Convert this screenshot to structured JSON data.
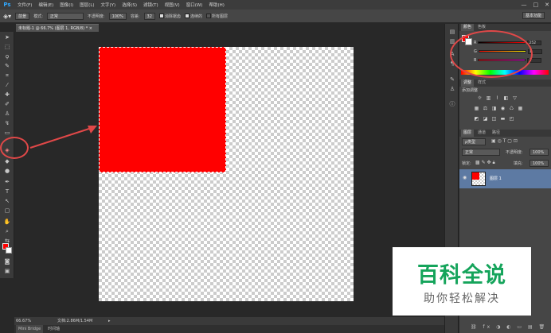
{
  "app": {
    "logo": "Ps",
    "menus": [
      "文件(F)",
      "编辑(E)",
      "图像(I)",
      "图层(L)",
      "文字(Y)",
      "选择(S)",
      "滤镜(T)",
      "视图(V)",
      "窗口(W)",
      "帮助(H)"
    ],
    "window_controls": [
      "—",
      "□",
      "✕"
    ]
  },
  "options": {
    "fill_source": "前景",
    "mode_label": "模式:",
    "mode_value": "正常",
    "opacity_label": "不透明度:",
    "opacity_value": "100%",
    "tolerance_label": "容差:",
    "tolerance_value": "32",
    "antialias_label": "消除锯齿",
    "contiguous_label": "连续的",
    "all_layers_label": "所有图层",
    "workspace": "基本功能"
  },
  "document": {
    "tab_label": "未标题-1 @ 66.7% (图层 1, RGB/8) *  ×",
    "zoom": "66.67%",
    "doc_info": "文档:2.86M/1.54M"
  },
  "bottom_tabs": [
    "Mini Bridge",
    "时间轴"
  ],
  "color_panel": {
    "tabs": [
      "颜色",
      "色板"
    ],
    "channels": [
      {
        "label": "R",
        "value": "252"
      },
      {
        "label": "G",
        "value": "1"
      },
      {
        "label": "B",
        "value": "1"
      }
    ],
    "foreground": "#ff0000"
  },
  "adjust_panel": {
    "tabs": [
      "调整",
      "样式"
    ],
    "title": "添加调整"
  },
  "layers_panel": {
    "tabs": [
      "图层",
      "通道",
      "路径"
    ],
    "filter_label": "ρ类型",
    "blend_mode": "正常",
    "opacity_label": "不透明度:",
    "opacity_value": "100%",
    "lock_label": "锁定:",
    "fill_label": "填充:",
    "fill_value": "100%",
    "layers": [
      {
        "name": "图层 1"
      }
    ]
  },
  "watermark": {
    "title": "百科全说",
    "subtitle": "助你轻松解决"
  }
}
